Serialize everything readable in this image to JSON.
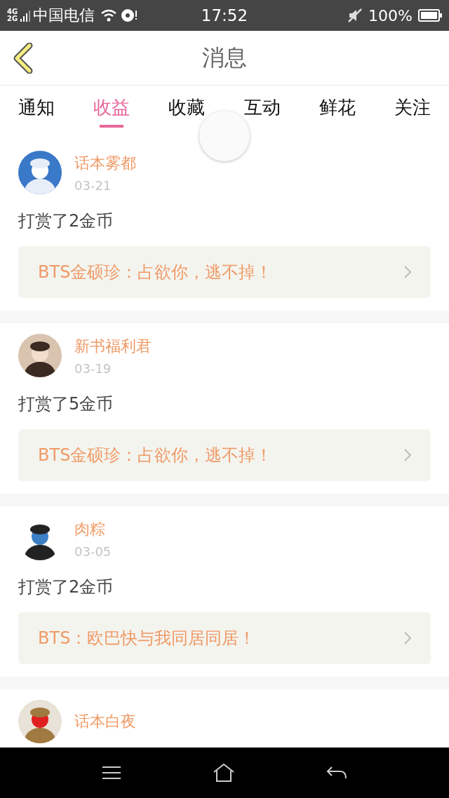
{
  "status_bar": {
    "network_top": "4G",
    "network_bottom": "2G",
    "carrier": "中国电信",
    "time": "17:52",
    "battery": "100%"
  },
  "header": {
    "title": "消息"
  },
  "tabs": [
    {
      "label": "通知",
      "selected": false
    },
    {
      "label": "收益",
      "selected": true
    },
    {
      "label": "收藏",
      "selected": false
    },
    {
      "label": "互动",
      "selected": false
    },
    {
      "label": "鲜花",
      "selected": false
    },
    {
      "label": "关注",
      "selected": false
    }
  ],
  "messages": [
    {
      "name": "话本雾都",
      "date": "03-21",
      "text": "打赏了2金币",
      "book": "BTS金硕珍：占欲你，逃不掉！"
    },
    {
      "name": "新书福利君",
      "date": "03-19",
      "text": "打赏了5金币",
      "book": "BTS金硕珍：占欲你，逃不掉！"
    },
    {
      "name": "肉粽",
      "date": "03-05",
      "text": "打赏了2金币",
      "book": "BTS：欧巴快与我同居同居！"
    },
    {
      "name": "话本白夜"
    }
  ]
}
